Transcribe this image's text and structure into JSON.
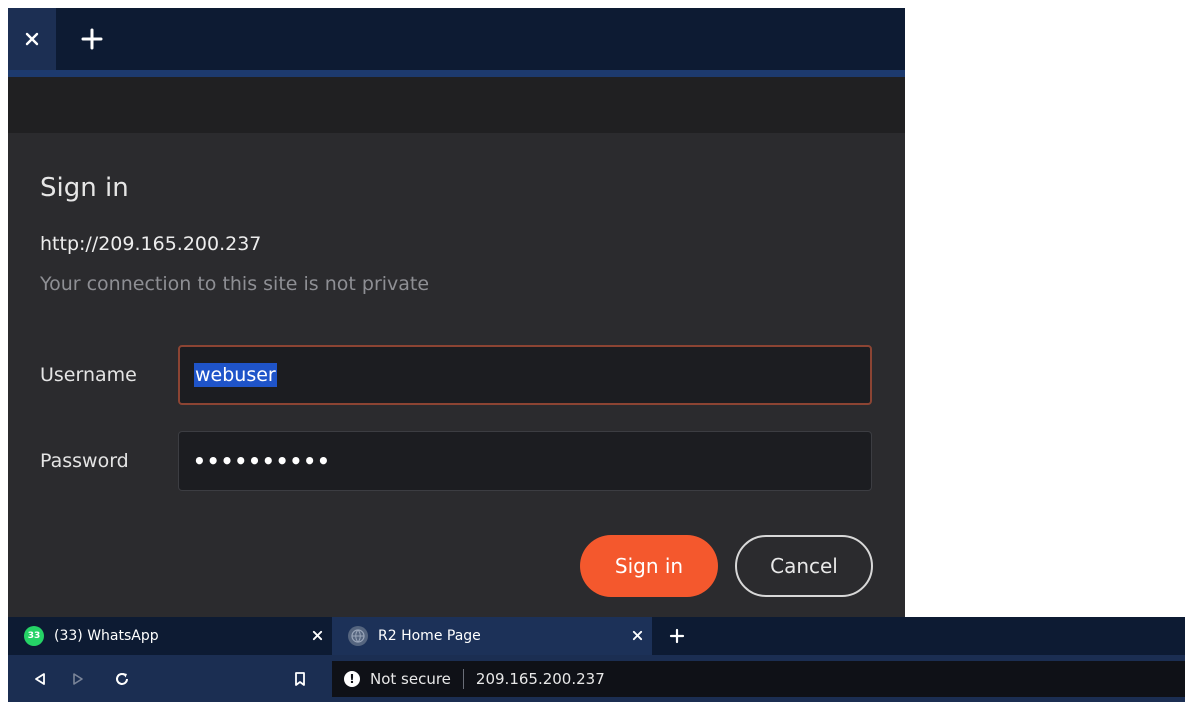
{
  "dialog": {
    "title": "Sign in",
    "origin": "http://209.165.200.237",
    "warning": "Your connection to this site is not private",
    "username_label": "Username",
    "username_value": "webuser",
    "password_label": "Password",
    "password_masked": "••••••••••",
    "signin_label": "Sign in",
    "cancel_label": "Cancel"
  },
  "tabs": [
    {
      "title": "(33) WhatsApp",
      "badge": "33",
      "icon": "whatsapp-icon"
    },
    {
      "title": "R2 Home Page",
      "icon": "globe-icon"
    }
  ],
  "address_bar": {
    "security": "Not secure",
    "url": "209.165.200.237"
  },
  "colors": {
    "accent": "#f4582d",
    "focus_border": "#8c4433",
    "selection": "#1f54c9",
    "tabstrip": "#0d1b33",
    "toolbar": "#1b2e52"
  }
}
